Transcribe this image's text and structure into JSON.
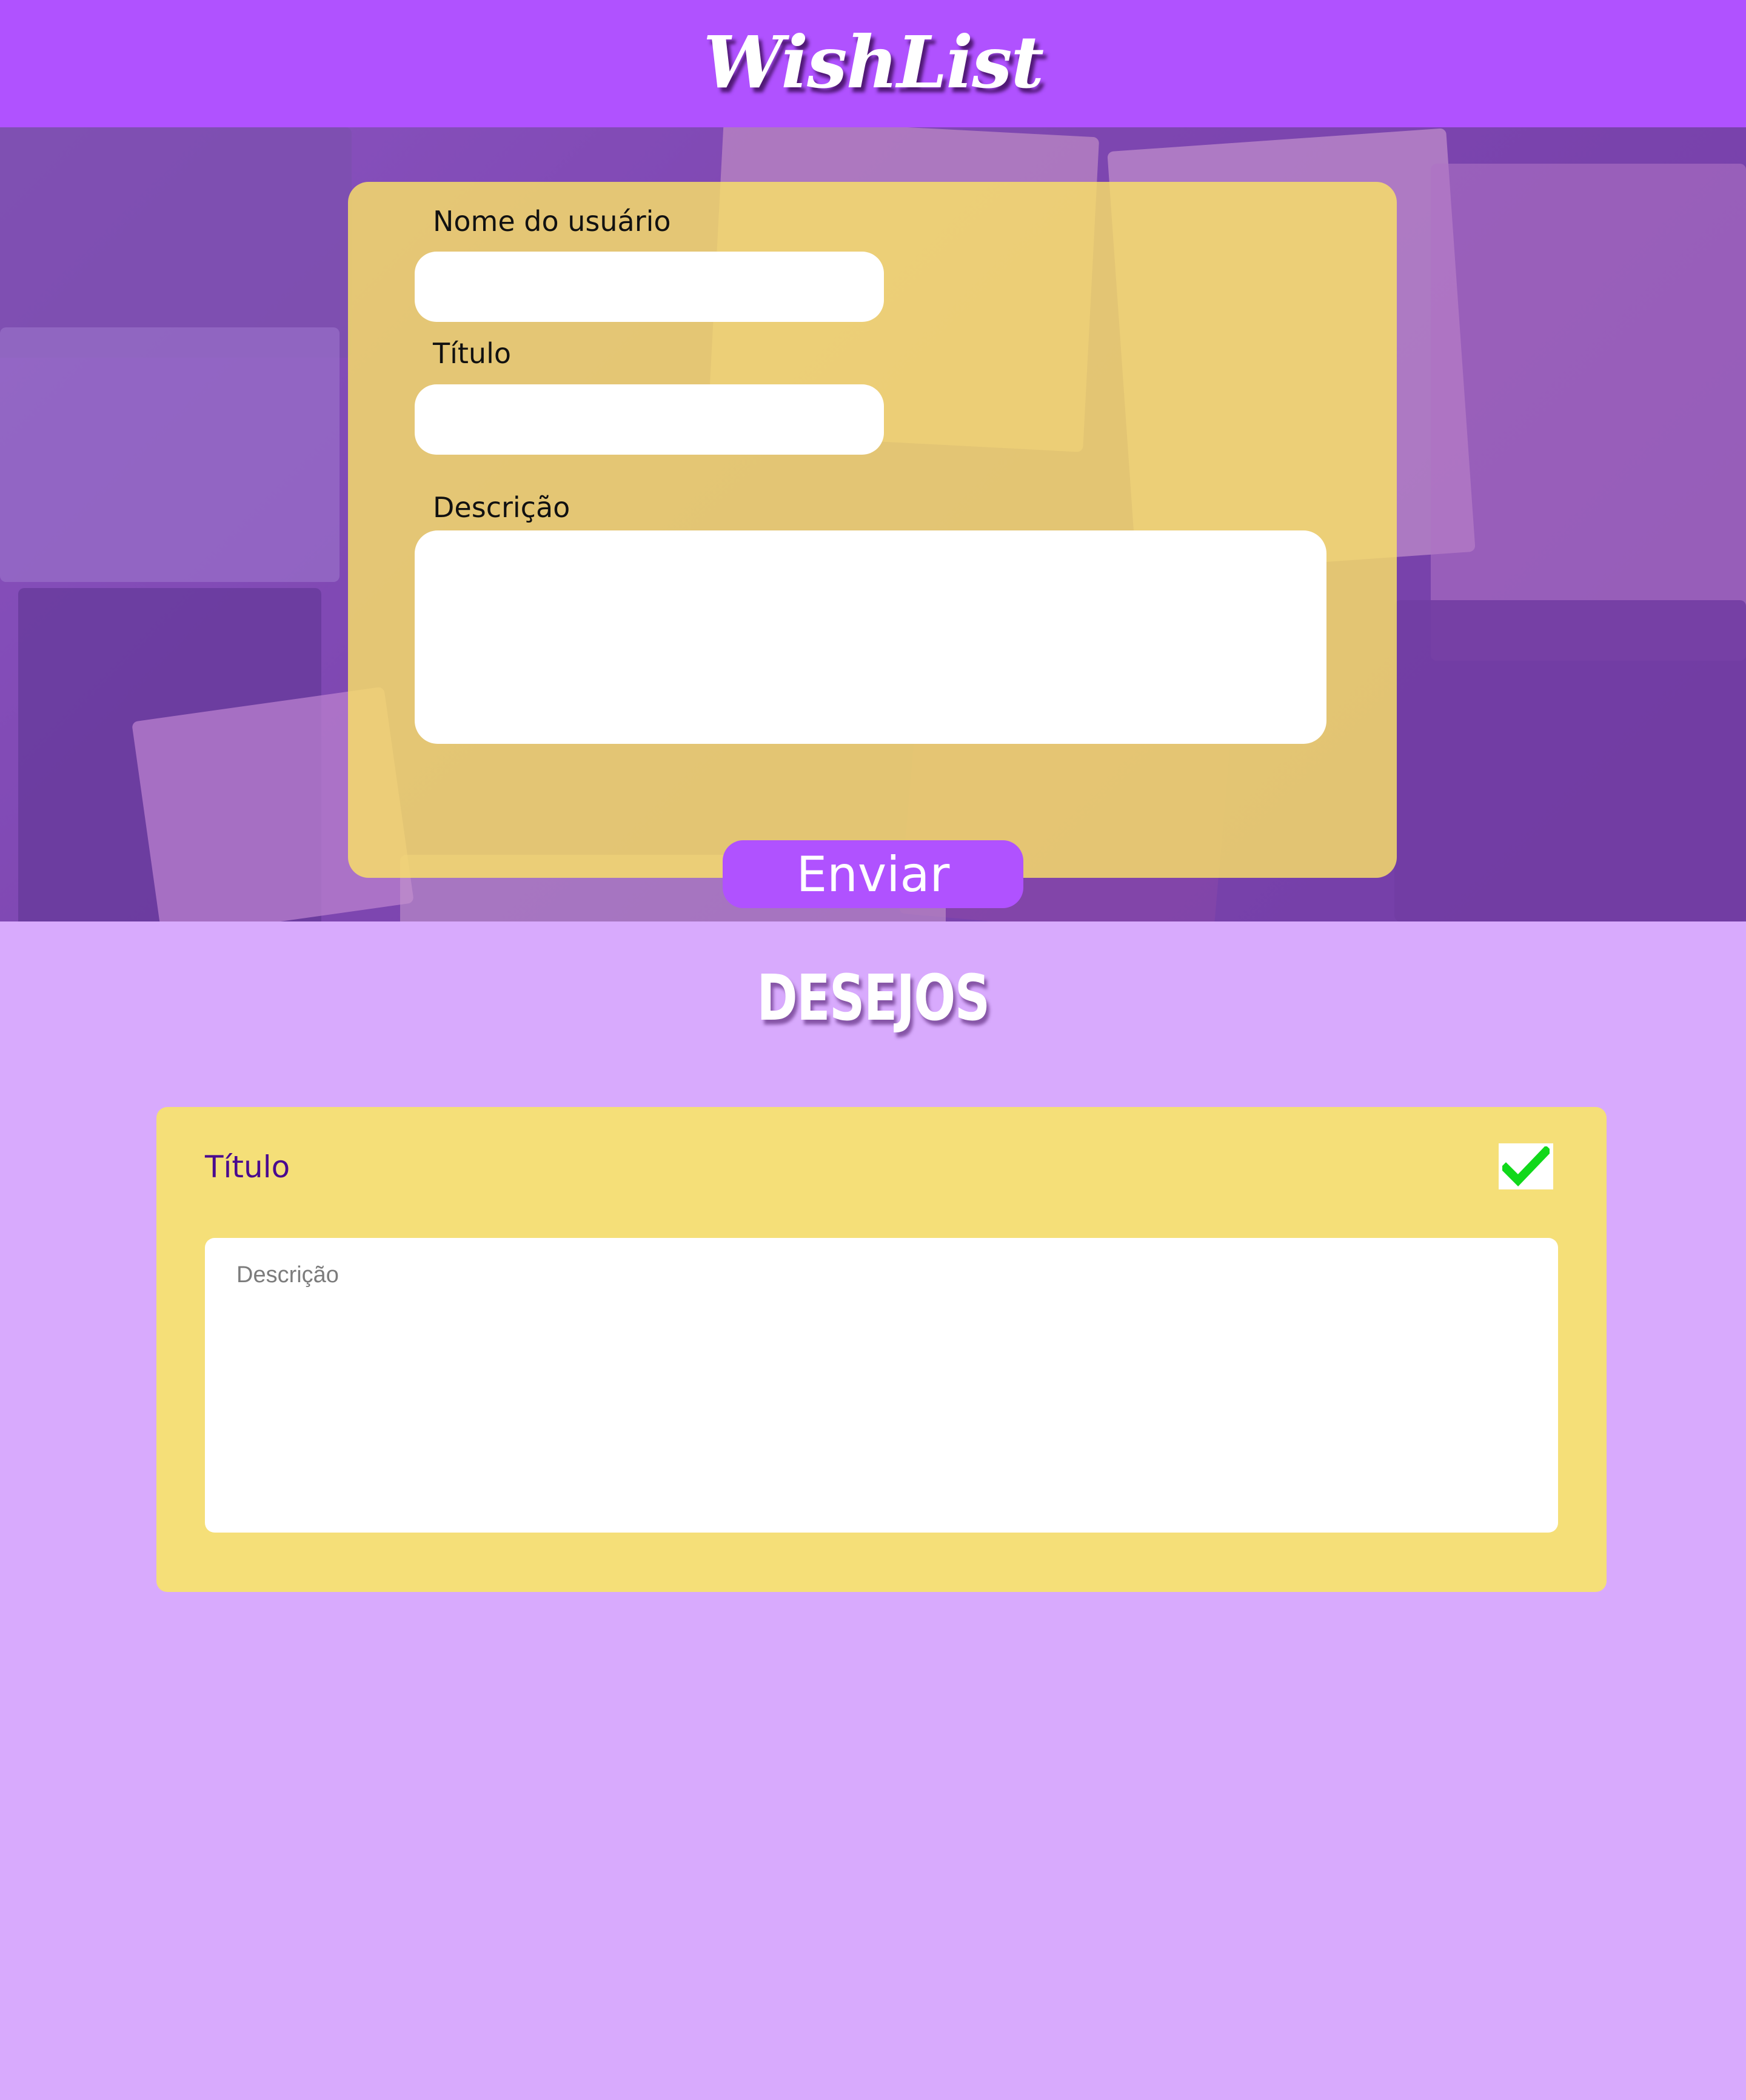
{
  "header": {
    "logo_text": "WishList"
  },
  "form": {
    "username_label": "Nome do usuário",
    "username_value": "",
    "title_label": "Título",
    "title_value": "",
    "description_label": "Descrição",
    "description_value": "",
    "send_label": "Enviar"
  },
  "wishes": {
    "section_title": "DESEJOS",
    "items": [
      {
        "title": "Título",
        "description_placeholder": "Descrição",
        "done_icon": "check-icon"
      }
    ]
  },
  "colors": {
    "header": "#b052ff",
    "page_background": "#d8aafd",
    "card_yellow": "#f5df78",
    "button": "#b052ff",
    "wish_title": "#4a0a8f",
    "check": "#11d81a"
  }
}
